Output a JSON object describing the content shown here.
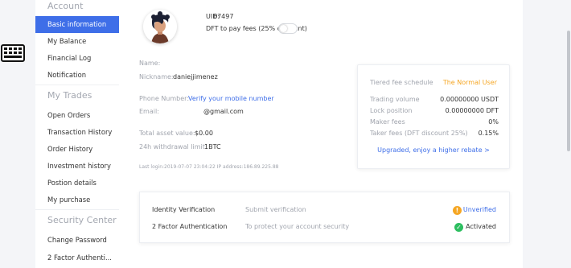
{
  "colors": {
    "accent": "#3e6ee8",
    "orange": "#f5a623",
    "success": "#2dbe60",
    "muted": "#a0a4ad"
  },
  "sidebar": {
    "account_title": "Account",
    "account_items": [
      "Basic information",
      "My Balance",
      "Financial Log",
      "Notification"
    ],
    "trades_title": "My Trades",
    "trades_items": [
      "Open Orders",
      "Transaction History",
      "Order History",
      "Investment history",
      "Postion details",
      "My purchase"
    ],
    "security_title": "Security Center",
    "security_items": [
      "Change Password",
      "2 Factor Authenti..."
    ]
  },
  "profile": {
    "uid_label": "UID:",
    "uid_value": "67497",
    "dft_toggle_label": "DFT to pay fees (25% discount)",
    "dft_enabled": false
  },
  "info": {
    "name_label": "Name:",
    "name_value": "",
    "nickname_label": "Nickname:",
    "nickname_value": "daniejjimenez",
    "phone_label": "Phone Number:",
    "phone_link": "Verify your mobile number",
    "email_label": "Email:",
    "email_value": "@gmail.com",
    "total_asset_label": "Total asset value:",
    "total_asset_value": "$0.00",
    "withdrawal_label": "24h withdrawal limit:",
    "withdrawal_value": "1BTC",
    "last_login": "Last login:2019-07-07 23:04:22 IP address:186.89.225.88"
  },
  "fees": {
    "schedule_label": "Tiered fee schedule",
    "tier": "The Normal User",
    "rows": [
      {
        "label": "Trading volume",
        "value": "0.00000000 USDT"
      },
      {
        "label": "Lock position",
        "value": "0.00000000 DFT"
      },
      {
        "label": "Maker fees",
        "value": "0%"
      },
      {
        "label": "Taker fees (DFT discount 25%)",
        "value": "0.15%"
      }
    ],
    "upgrade_link": "Upgraded, enjoy a higher rebate >"
  },
  "security": {
    "rows": [
      {
        "title": "Identity Verification",
        "desc": "Submit verification",
        "status": "Unverified",
        "icon": "warning-icon"
      },
      {
        "title": "2 Factor Authentication",
        "desc": "To protect your account security",
        "status": "Activated",
        "icon": "check-icon"
      }
    ]
  }
}
